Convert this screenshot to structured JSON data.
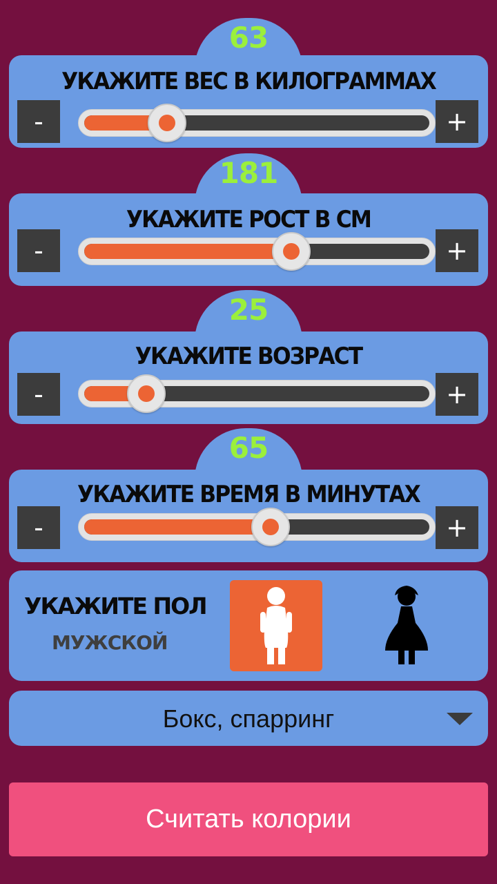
{
  "weight": {
    "value": "63",
    "title": "УКАЖИТЕ ВЕС В КИЛОГРАММАХ",
    "minus": "-",
    "plus": "+",
    "fill_percent": 24
  },
  "height": {
    "value": "181",
    "title": "УКАЖИТЕ РОСТ В СМ",
    "minus": "-",
    "plus": "+",
    "fill_percent": 60
  },
  "age": {
    "value": "25",
    "title": "УКАЖИТЕ ВОЗРАСТ",
    "minus": "-",
    "plus": "+",
    "fill_percent": 18
  },
  "duration": {
    "value": "65",
    "title": "УКАЖИТЕ ВРЕМЯ В МИНУТАХ",
    "minus": "-",
    "plus": "+",
    "fill_percent": 54
  },
  "gender": {
    "title": "УКАЖИТЕ ПОЛ",
    "selected": "МУЖСКОЙ",
    "male_icon": "male-person-icon",
    "female_icon": "female-person-icon"
  },
  "activity": {
    "selected": "Бокс, спарринг",
    "icon": "dropdown-arrow-icon"
  },
  "calculate_label": "Считать колории",
  "colors": {
    "background": "#74103f",
    "card": "#6b9be3",
    "accent": "#ec6434",
    "value_text": "#9bef3c",
    "button": "#3c3c3c",
    "calculate_button": "#f0507e"
  }
}
